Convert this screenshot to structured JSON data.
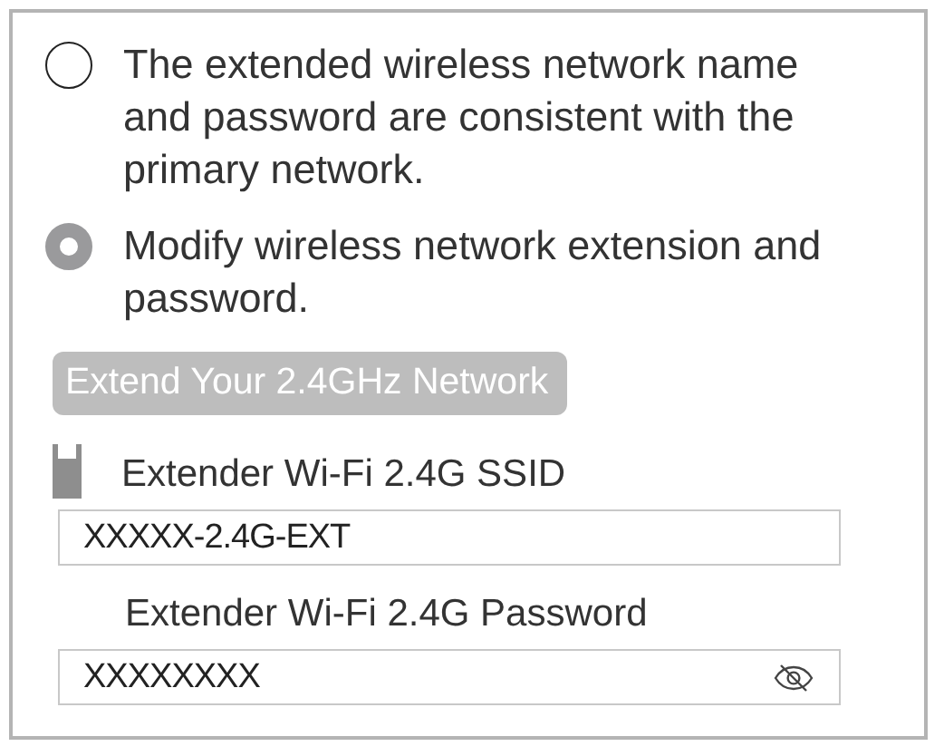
{
  "options": [
    {
      "label": "The extended wireless network name and password are consistent with the primary network.",
      "selected": false
    },
    {
      "label": "Modify wireless network extension and password.",
      "selected": true
    }
  ],
  "section_title": "Extend Your 2.4GHz Network",
  "fields": [
    {
      "kind": "text",
      "label": "Extender Wi-Fi 2.4G SSID",
      "value": "XXXXX-2.4G-EXT"
    },
    {
      "kind": "password",
      "label": "Extender Wi-Fi 2.4G Password",
      "value": "XXXXXXXX"
    }
  ]
}
